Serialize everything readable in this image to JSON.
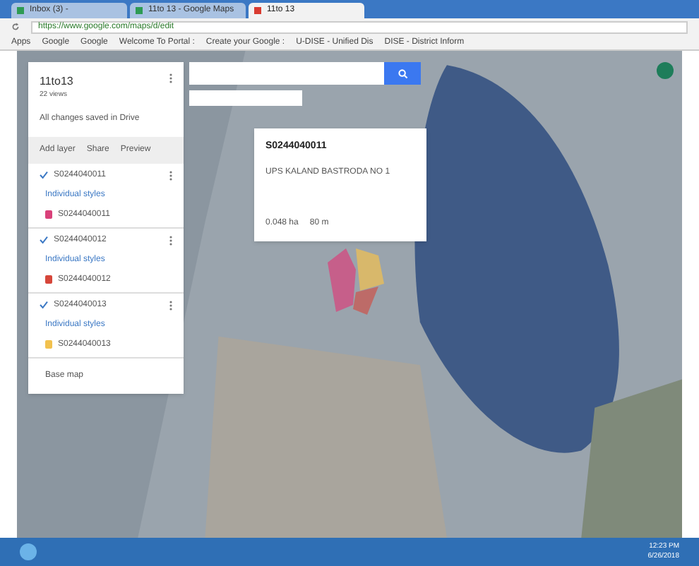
{
  "browser": {
    "tabs": [
      {
        "title": "Inbox (3) - ",
        "selected": false
      },
      {
        "title": "11to 13 - Google Maps",
        "selected": false
      },
      {
        "title": "11to 13",
        "selected": true
      }
    ],
    "url": "https://www.google.com/maps/d/edit",
    "bookmarks": [
      "Apps",
      "Google",
      "Google",
      "Welcome To Portal :",
      "Create your Google :",
      "U-DISE - Unified Dis",
      "DISE - District Inform"
    ]
  },
  "map_panel": {
    "title": "11to13",
    "views": "22 views",
    "status": "All changes saved in Drive",
    "actions": [
      "Add layer",
      "Share",
      "Preview"
    ],
    "layers": [
      {
        "name": "S0244040011",
        "checked": true,
        "style_label": "Individual styles",
        "feature": {
          "name": "S0244040011",
          "color": "#d9417a"
        }
      },
      {
        "name": "S0244040012",
        "checked": true,
        "style_label": "Individual styles",
        "feature": {
          "name": "S0244040012",
          "color": "#d6463a"
        }
      },
      {
        "name": "S0244040013",
        "checked": true,
        "style_label": "Individual styles",
        "feature": {
          "name": "S0244040013",
          "color": "#f2c14e"
        }
      }
    ],
    "base_map": "Base map"
  },
  "popup": {
    "title": "S0244040011",
    "description": "UPS KALAND BASTRODA NO 1",
    "area": "0.048 ha",
    "length": "80 m"
  },
  "taskbar": {
    "time": "12:23 PM",
    "date": "6/26/2018"
  }
}
